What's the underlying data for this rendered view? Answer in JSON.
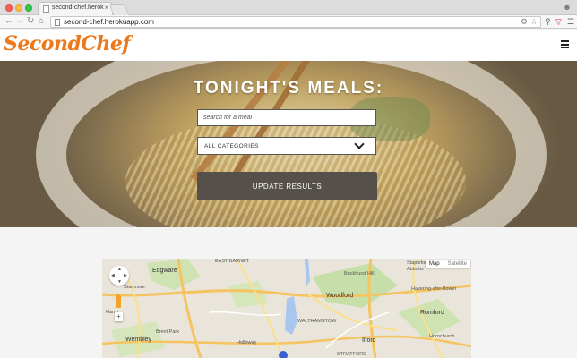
{
  "browser": {
    "tab_title": "second-chef.herokuapp.co",
    "tab_close": "×",
    "url": "second-chef.herokuapp.com"
  },
  "site": {
    "logo": "SecondChef"
  },
  "hero": {
    "title": "TONIGHT'S MEALS:",
    "search_placeholder": "search for a meal",
    "category_selected": "ALL CATEGORIES",
    "update_button": "UPDATE RESULTS"
  },
  "map": {
    "map_button": "Map",
    "satellite_button": "Satellite",
    "labels": {
      "edgware": "Edgware",
      "east_barnet": "EAST BARNET",
      "buckhurst_hill": "Buckhurst Hill",
      "stapleford": "Stapleford",
      "abbotts": "Abbotts",
      "havering": "Havering-atte-Bower",
      "woodford": "Woodford",
      "romford": "Romford",
      "hornchurch": "Hornchurch",
      "wembley": "Wembley",
      "brent_park": "Brent Park",
      "holloway": "Holloway",
      "walthamstow": "WALTHAMSTOW",
      "harrow": "Harro",
      "stanmore": "Stanmore",
      "stratford": "STRATFORD",
      "ilford": "Ilford"
    }
  }
}
